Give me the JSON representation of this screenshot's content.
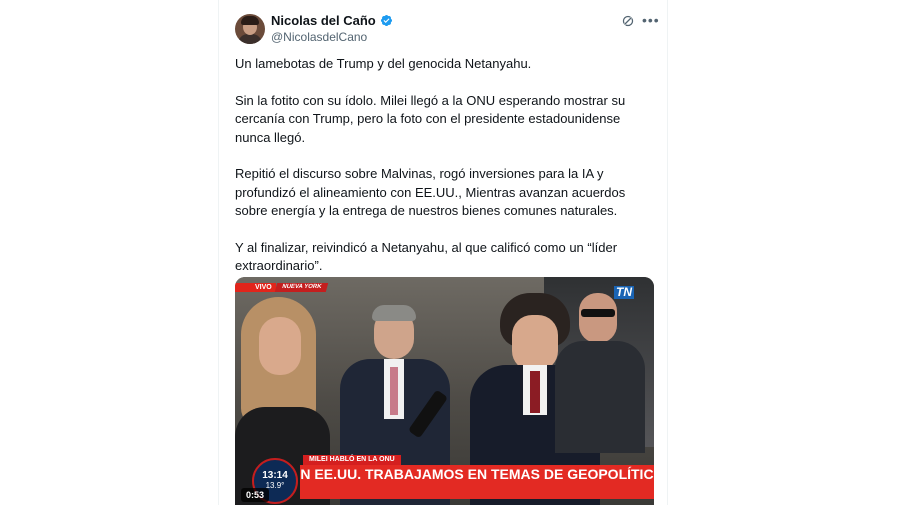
{
  "tweet": {
    "author_name": "Nicolas del Caño",
    "author_handle": "@NicolasdelCano",
    "paragraphs": [
      "Un lamebotas de Trump y del genocida Netanyahu.",
      "Sin la fotito con su ídolo. Milei llegó a la ONU esperando mostrar su cercanía con Trump, pero la foto con el presidente estadounidense nunca llegó.",
      "Repitió el discurso sobre Malvinas, rogó inversiones para la IA y profundizó el alineamiento con EE.UU., Mientras avanzan acuerdos sobre energía y la entrega de nuestros bienes comunes naturales.",
      "Y al finalizar, reivindicó a Netanyahu, al que calificó como un “líder extraordinario”."
    ]
  },
  "video": {
    "live_label": "VIVO",
    "location_label": "NUEVA YORK",
    "channel_logo": "TN",
    "lower_third_small": "MILEI HABLÓ EN LA ONU",
    "lower_third_big": "N EE.UU. TRABAJAMOS EN TEMAS DE GEOPOLÍTIC",
    "clock_time": "13:14",
    "clock_temp": "13.9°",
    "duration": "0:53"
  },
  "icons": {
    "verified": "verified-badge-icon",
    "grok": "grok-icon",
    "more": "more-options-icon"
  },
  "colors": {
    "accent_blue": "#1d9bf0",
    "text_primary": "#0f1419",
    "text_secondary": "#536471",
    "news_red": "#e32a23"
  }
}
